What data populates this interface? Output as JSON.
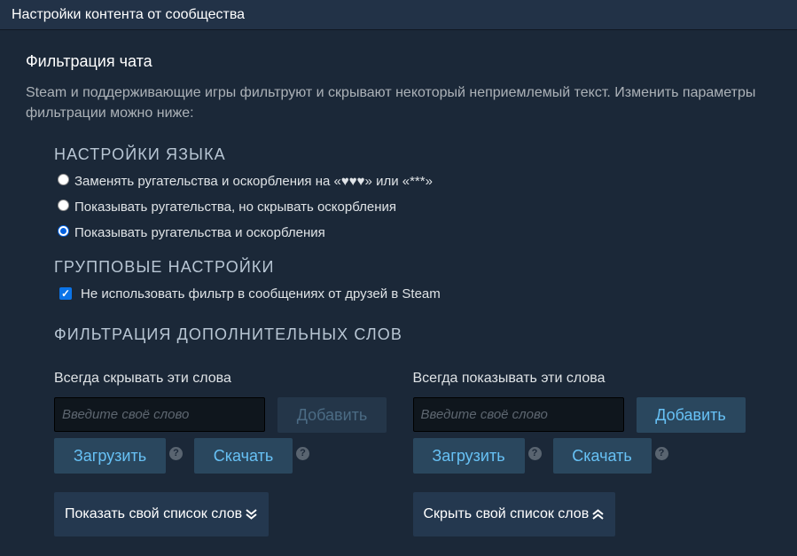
{
  "window": {
    "title": "Настройки контента от сообщества"
  },
  "chat_filter": {
    "title": "Фильтрация чата",
    "description": "Steam и поддерживающие игры фильтруют и скрывают некоторый неприемлемый текст. Изменить параметры фильтрации можно ниже:"
  },
  "language": {
    "heading": "НАСТРОЙКИ ЯЗЫКА",
    "options": [
      {
        "label": "Заменять ругательства и оскорбления на «♥♥♥» или «***»",
        "checked": false
      },
      {
        "label": "Показывать ругательства, но скрывать оскорбления",
        "checked": false
      },
      {
        "label": "Показывать ругательства и оскорбления",
        "checked": true
      }
    ]
  },
  "group": {
    "heading": "ГРУППОВЫЕ НАСТРОЙКИ",
    "checkbox_label": "Не использовать фильтр в сообщениях от друзей в Steam",
    "checked": true
  },
  "extra_words": {
    "heading": "ФИЛЬТРАЦИЯ ДОПОЛНИТЕЛЬНЫХ СЛОВ",
    "hide": {
      "label": "Всегда скрывать эти слова",
      "placeholder": "Введите своё слово",
      "add_label": "Добавить",
      "upload_label": "Загрузить",
      "download_label": "Скачать",
      "toggle_label": "Показать свой список слов",
      "toggle_icon": "double-chevron-down-icon"
    },
    "show": {
      "label": "Всегда показывать эти слова",
      "placeholder": "Введите своё слово",
      "add_label": "Добавить",
      "upload_label": "Загрузить",
      "download_label": "Скачать",
      "toggle_label": "Скрыть свой список слов",
      "toggle_icon": "double-chevron-up-icon"
    },
    "help_glyph": "?"
  },
  "colors": {
    "background": "#1b2838",
    "titlebar": "#223247",
    "button_bg": "#2a475e",
    "button_text": "#67c1f5",
    "checkbox": "#0b74e8"
  }
}
